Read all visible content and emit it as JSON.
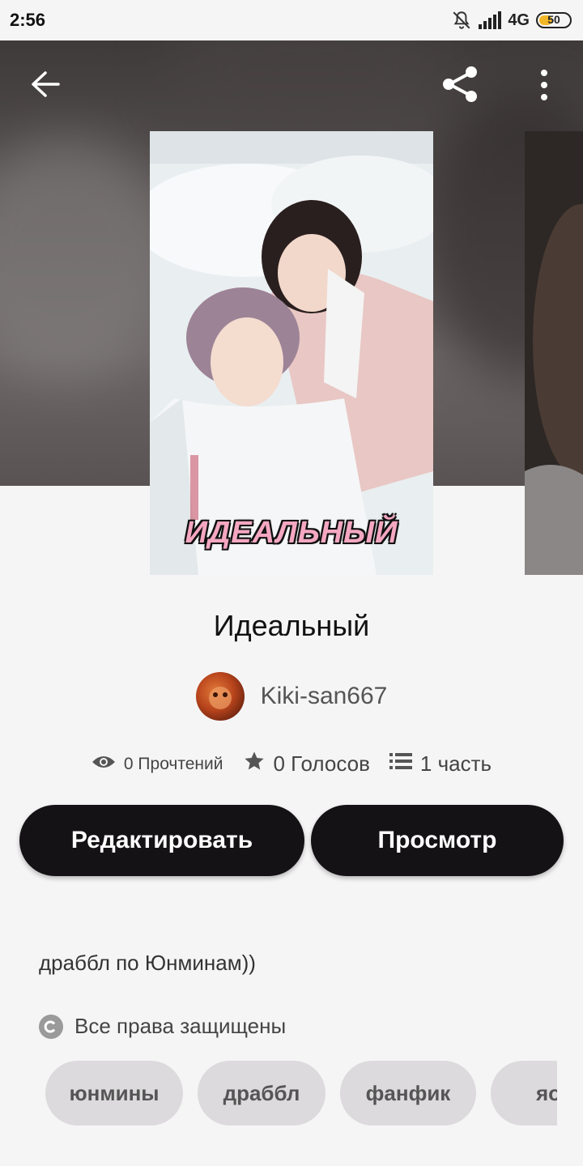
{
  "status_bar": {
    "time": "2:56",
    "network": "4G",
    "battery": "50",
    "battery_level": 0.5,
    "icons": [
      "bell-muted-icon",
      "signal-icon",
      "battery-icon"
    ]
  },
  "toolbar": {
    "icons": [
      "back-arrow-icon",
      "share-icon",
      "more-vert-icon"
    ]
  },
  "cover": {
    "title": "ИДЕАЛЬНЫЙ"
  },
  "story": {
    "title": "Идеальный",
    "author": "Kiki-san667",
    "reads": "0 Прочтений",
    "votes": "0 Голосов",
    "parts": "1 часть",
    "description": "драббл по Юнминам))",
    "copyright": "Все права защищены"
  },
  "actions": {
    "edit_label": "Редактировать",
    "view_label": "Просмотр"
  },
  "tags": [
    "юнмины",
    "драббл",
    "фанфик",
    "яо"
  ],
  "colors": {
    "button_bg": "#141214",
    "tag_bg": "#dcdadc",
    "page_bg": "#f6f5f6",
    "battery_fill": "#f2b728"
  }
}
